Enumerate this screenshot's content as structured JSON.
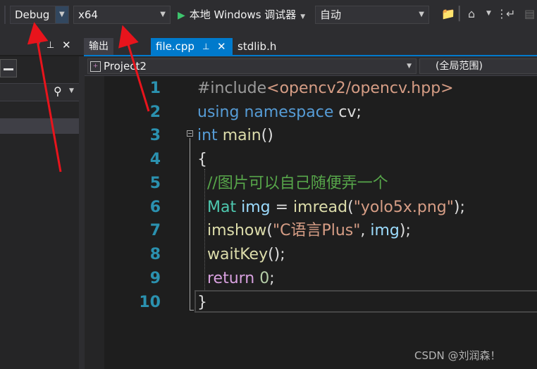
{
  "toolbar": {
    "configuration": "Debug",
    "platform": "x64",
    "debugger_label": "本地 Windows 调试器",
    "mode": "自动"
  },
  "tabs": {
    "output": "输出",
    "active_file": "file.cpp",
    "other_file": "stdlib.h"
  },
  "navigation": {
    "project": "Project2",
    "scope": "(全局范围)"
  },
  "editor": {
    "line_numbers": [
      "1",
      "2",
      "3",
      "4",
      "5",
      "6",
      "7",
      "8",
      "9",
      "10"
    ]
  },
  "watermark": "CSDN @刘润森！",
  "colors": {
    "accent": "#007acc",
    "annotation_arrow": "#e8141c"
  }
}
